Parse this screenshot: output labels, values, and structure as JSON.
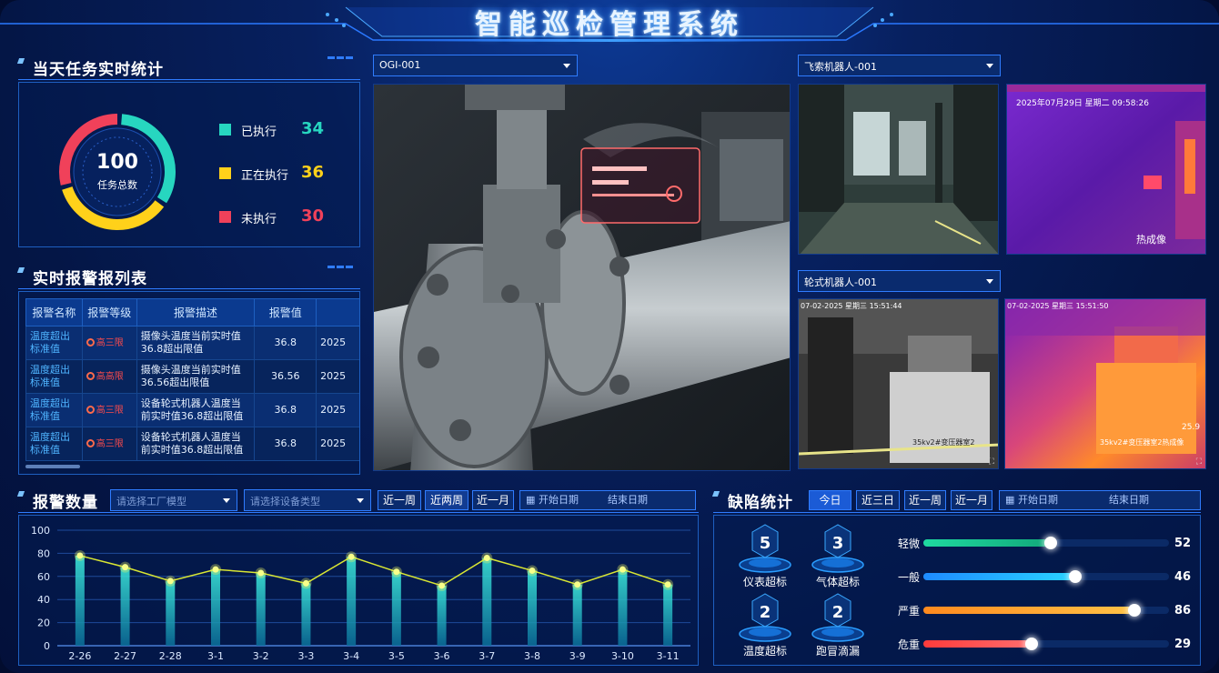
{
  "header": {
    "title": "智能巡检管理系统"
  },
  "stats": {
    "title": "当天任务实时统计",
    "total_value": "100",
    "total_label": "任务总数",
    "items": [
      {
        "label": "已执行",
        "value": "34",
        "color": "#27d6c0",
        "fraction": 0.34
      },
      {
        "label": "正在执行",
        "value": "36",
        "color": "#ffd11a",
        "fraction": 0.36
      },
      {
        "label": "未执行",
        "value": "30",
        "color": "#f0415a",
        "fraction": 0.3
      }
    ]
  },
  "alarms": {
    "title": "实时报警报列表",
    "columns": [
      "报警名称",
      "报警等级",
      "报警描述",
      "报警值",
      ""
    ],
    "rows": [
      {
        "name": "温度超出标准值",
        "level": "高三限",
        "desc": "摄像头温度当前实时值36.8超出限值",
        "value": "36.8",
        "time": "2025"
      },
      {
        "name": "温度超出标准值",
        "level": "高高限",
        "desc": "摄像头温度当前实时值36.56超出限值",
        "value": "36.56",
        "time": "2025"
      },
      {
        "name": "温度超出标准值",
        "level": "高三限",
        "desc": "设备轮式机器人温度当前实时值36.8超出限值",
        "value": "36.8",
        "time": "2025"
      },
      {
        "name": "温度超出标准值",
        "level": "高三限",
        "desc": "设备轮式机器人温度当前实时值36.8超出限值",
        "value": "36.8",
        "time": "2025"
      }
    ]
  },
  "main_video": {
    "select": "OGI-001"
  },
  "robot_a": {
    "select": "飞索机器人-001",
    "thermal_stamp": "2025年07月29日 星期二 09:58:26",
    "thermal_caption": "热成像"
  },
  "robot_b": {
    "select": "轮式机器人-001",
    "stamp_left": "07-02-2025 星期三 15:51:44",
    "stamp_right": "07-02-2025 星期三 15:51:50",
    "caption_left": "35kv2#变压器室2",
    "caption_right": "35kv2#变压器室2热成像",
    "temp": "25.9"
  },
  "alarm_count": {
    "title": "报警数量",
    "factory_placeholder": "请选择工厂模型",
    "device_placeholder": "请选择设备类型",
    "btns": [
      "近一周",
      "近两周",
      "近一月"
    ],
    "start": "开始日期",
    "end": "结束日期"
  },
  "chart_data": {
    "type": "bar",
    "categories": [
      "2-26",
      "2-27",
      "2-28",
      "3-1",
      "3-2",
      "3-3",
      "3-4",
      "3-5",
      "3-6",
      "3-7",
      "3-8",
      "3-9",
      "3-10",
      "3-11"
    ],
    "values": [
      78,
      68,
      56,
      66,
      63,
      54,
      77,
      64,
      52,
      76,
      65,
      53,
      66,
      53
    ],
    "ylim": [
      0,
      100
    ],
    "yticks": [
      0,
      20,
      40,
      60,
      80,
      100
    ],
    "grid": true,
    "line_values": [
      78,
      68,
      56,
      66,
      63,
      54,
      77,
      64,
      52,
      76,
      65,
      53,
      66,
      53
    ]
  },
  "defects": {
    "title": "缺陷统计",
    "btns": [
      "今日",
      "近三日",
      "近一周",
      "近一月"
    ],
    "start": "开始日期",
    "end": "结束日期",
    "items": [
      {
        "num": "5",
        "label": "仪表超标"
      },
      {
        "num": "3",
        "label": "气体超标"
      },
      {
        "num": "2",
        "label": "温度超标"
      },
      {
        "num": "2",
        "label": "跑冒滴漏"
      }
    ],
    "severity": [
      {
        "label": "轻微",
        "value": "52",
        "fraction": 0.52,
        "c1": "#1fd9a0",
        "c2": "#12a87a"
      },
      {
        "label": "一般",
        "value": "46",
        "fraction": 0.62,
        "c1": "#1e8bff",
        "c2": "#29d3ff"
      },
      {
        "label": "严重",
        "value": "86",
        "fraction": 0.86,
        "c1": "#ff8a1e",
        "c2": "#ffc247"
      },
      {
        "label": "危重",
        "value": "29",
        "fraction": 0.44,
        "c1": "#ff3b3b",
        "c2": "#ff6d6d"
      }
    ]
  }
}
